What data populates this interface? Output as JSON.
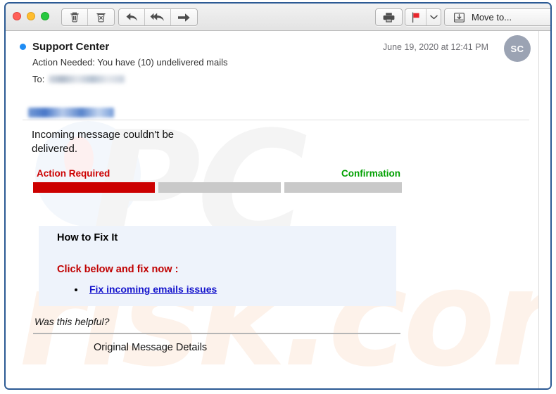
{
  "window": {
    "accent_border": "#2c5a94",
    "traffic_lights": [
      {
        "name": "close",
        "color": "#ff5f57"
      },
      {
        "name": "minimize",
        "color": "#ffbd2e"
      },
      {
        "name": "maximize",
        "color": "#28c840"
      }
    ]
  },
  "toolbar": {
    "delete_label": "Delete",
    "junk_label": "Junk",
    "reply_label": "Reply",
    "reply_all_label": "Reply All",
    "forward_label": "Forward",
    "print_label": "Print",
    "flag_label": "Flag",
    "flag_color": "#e8262c",
    "flag_menu_label": "Flag options",
    "move_to_label": "Move to..."
  },
  "header": {
    "sender": "Support Center",
    "subject": "Action Needed: You have (10) undelivered mails",
    "to_label": "To:",
    "to_value_redacted": true,
    "date": "June 19, 2020 at 12:41 PM",
    "avatar_initials": "SC",
    "unread": true
  },
  "body": {
    "sender_email_redacted": true,
    "message_line": "Incoming message  couldn't be delivered.",
    "progress": {
      "left_label": "Action Required",
      "left_label_color": "#cc0000",
      "right_label": "Confirmation",
      "right_label_color": "#00a000",
      "segments": [
        {
          "name": "action-required",
          "color": "#cc0000",
          "filled": true
        },
        {
          "name": "in-progress",
          "color": "#c9c9c9",
          "filled": false
        },
        {
          "name": "confirmation",
          "color": "#c9c9c9",
          "filled": false
        }
      ]
    },
    "fixbox": {
      "background": "#eef3fb",
      "title": "How to Fix It",
      "cta": "Click below and fix now :",
      "link_text": "Fix incoming emails issues",
      "link_color": "#1414cc"
    },
    "helpful_text": "Was this helpful?",
    "original_message_details": "Original Message Details"
  },
  "watermark": {
    "primary": "PC",
    "secondary": "risk.com"
  }
}
